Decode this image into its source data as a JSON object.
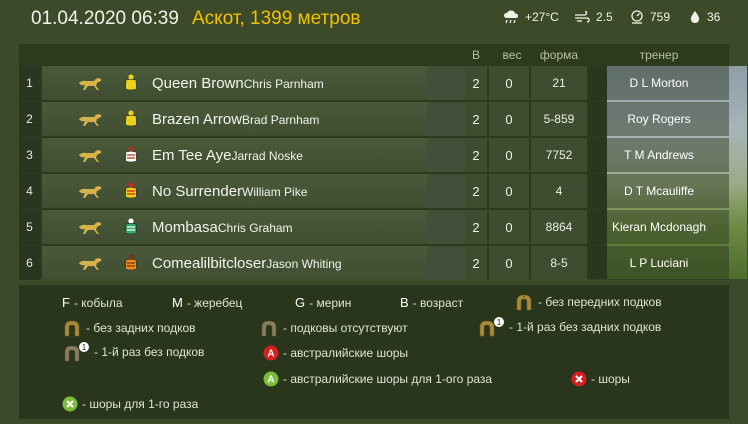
{
  "header": {
    "datetime": "01.04.2020 06:39",
    "venue": "Аскот, 1399 метров",
    "temp": "+27°C",
    "wind": "2.5",
    "pressure": "759",
    "humidity": "36"
  },
  "columns": {
    "b": "В",
    "w": "вес",
    "f": "форма",
    "t": "тренер"
  },
  "rows": [
    {
      "num": "1",
      "horse": "Queen Brown",
      "jockey": "Chris Parnham",
      "b": "2",
      "w": "0",
      "form": "21",
      "trainer": "D L Morton"
    },
    {
      "num": "2",
      "horse": "Brazen Arrow",
      "jockey": "Brad Parnham",
      "b": "2",
      "w": "0",
      "form": "5-859",
      "trainer": "Roy Rogers"
    },
    {
      "num": "3",
      "horse": "Em Tee Aye",
      "jockey": "Jarrad Noske",
      "b": "2",
      "w": "0",
      "form": "7752",
      "trainer": "T M Andrews"
    },
    {
      "num": "4",
      "horse": "No Surrender",
      "jockey": "William Pike",
      "b": "2",
      "w": "0",
      "form": "4",
      "trainer": "D T Mcauliffe"
    },
    {
      "num": "5",
      "horse": "Mombasa",
      "jockey": "Chris Graham",
      "b": "2",
      "w": "0",
      "form": "8864",
      "trainer": "Kieran Mcdonagh"
    },
    {
      "num": "6",
      "horse": "Comealilbitcloser",
      "jockey": "Jason Whiting",
      "b": "2",
      "w": "0",
      "form": "8-5",
      "trainer": "L P Luciani"
    }
  ],
  "legend": {
    "f_key": "F",
    "f_text": "- кобыла",
    "m_key": "M",
    "m_text": "- жеребец",
    "g_key": "G",
    "g_text": "- мерин",
    "b_key": "B",
    "b_text": "- возраст",
    "no_front": "- без передних подков",
    "no_hind": "- без задних подков",
    "no_shoes": "- подковы отсутствуют",
    "first_no_hind": "- 1-й раз без задних подков",
    "first_no_shoes": "- 1-й раз без подков",
    "aus_blinkers": "- австралийские шоры",
    "aus_blinkers_first": "- австралийские шоры для 1-ого раза",
    "blinkers": "- шоры",
    "blinkers_first": "- шоры для 1-го раза",
    "badge_1": "1",
    "badge_a": "A"
  },
  "colors": {
    "venue": "#f2c200",
    "blinkers_red": "#d52020",
    "blinkers_green": "#7bbd3a"
  }
}
